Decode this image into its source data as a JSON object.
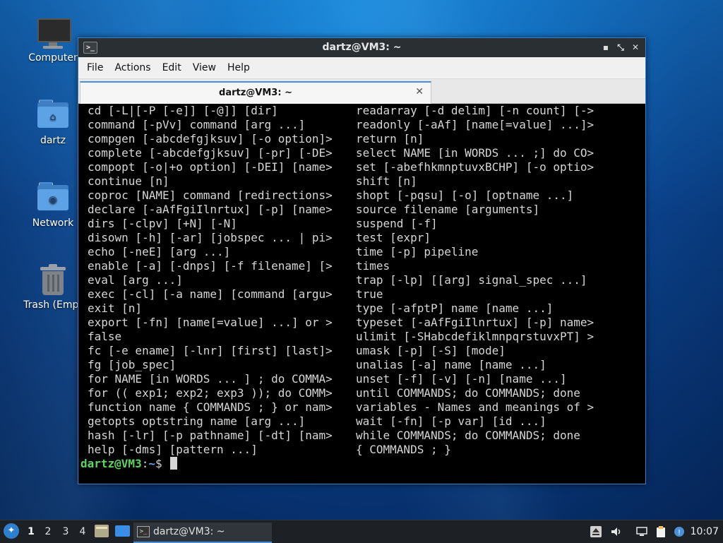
{
  "desktop": {
    "icons": [
      {
        "label": "Computer",
        "icon": "computer-icon"
      },
      {
        "label": "dartz",
        "icon": "home-folder-icon"
      },
      {
        "label": "Network",
        "icon": "network-folder-icon"
      },
      {
        "label": "Trash (Empt",
        "icon": "trash-icon"
      }
    ]
  },
  "window": {
    "title": "dartz@VM3: ~",
    "buttons": {
      "minimize": "▪",
      "maximize": "⤡",
      "close": "✕"
    },
    "menu": [
      "File",
      "Actions",
      "Edit",
      "View",
      "Help"
    ],
    "tab": {
      "title": "dartz@VM3: ~",
      "close": "✕"
    }
  },
  "terminal": {
    "left_column": [
      "cd [-L|[-P [-e]] [-@]] [dir]",
      "command [-pVv] command [arg ...]",
      "compgen [-abcdefgjksuv] [-o option]>",
      "complete [-abcdefgjksuv] [-pr] [-DE>",
      "compopt [-o|+o option] [-DEI] [name>",
      "continue [n]",
      "coproc [NAME] command [redirections>",
      "declare [-aAfFgiIlnrtux] [-p] [name>",
      "dirs [-clpv] [+N] [-N]",
      "disown [-h] [-ar] [jobspec ... | pi>",
      "echo [-neE] [arg ...]",
      "enable [-a] [-dnps] [-f filename] [>",
      "eval [arg ...]",
      "exec [-cl] [-a name] [command [argu>",
      "exit [n]",
      "export [-fn] [name[=value] ...] or >",
      "false",
      "fc [-e ename] [-lnr] [first] [last]>",
      "fg [job_spec]",
      "for NAME [in WORDS ... ] ; do COMMA>",
      "for (( exp1; exp2; exp3 )); do COMM>",
      "function name { COMMANDS ; } or nam>",
      "getopts optstring name [arg ...]",
      "hash [-lr] [-p pathname] [-dt] [nam>",
      "help [-dms] [pattern ...]"
    ],
    "right_column": [
      "readarray [-d delim] [-n count] [->",
      "readonly [-aAf] [name[=value] ...]>",
      "return [n]",
      "select NAME [in WORDS ... ;] do CO>",
      "set [-abefhkmnptuvxBCHP] [-o optio>",
      "shift [n]",
      "shopt [-pqsu] [-o] [optname ...]",
      "source filename [arguments]",
      "suspend [-f]",
      "test [expr]",
      "time [-p] pipeline",
      "times",
      "trap [-lp] [[arg] signal_spec ...]",
      "true",
      "type [-afptP] name [name ...]",
      "typeset [-aAfFgiIlnrtux] [-p] name>",
      "ulimit [-SHabcdefiklmnpqrstuvxPT] >",
      "umask [-p] [-S] [mode]",
      "unalias [-a] name [name ...]",
      "unset [-f] [-v] [-n] [name ...]",
      "until COMMANDS; do COMMANDS; done",
      "variables - Names and meanings of >",
      "wait [-fn] [-p var] [id ...]",
      "while COMMANDS; do COMMANDS; done",
      "{ COMMANDS ; }"
    ],
    "prompt": {
      "user_host": "dartz@VM3",
      "separator": ":",
      "path": "~",
      "symbol": "$ "
    }
  },
  "taskbar": {
    "workspaces": [
      "1",
      "2",
      "3",
      "4"
    ],
    "active_workspace": "1",
    "task": {
      "label": "dartz@VM3: ~"
    },
    "clock": "10:07"
  },
  "colors": {
    "prompt_user": "#5fd35f",
    "prompt_path": "#6a9ef0",
    "window_border": "#3a7fc9"
  }
}
